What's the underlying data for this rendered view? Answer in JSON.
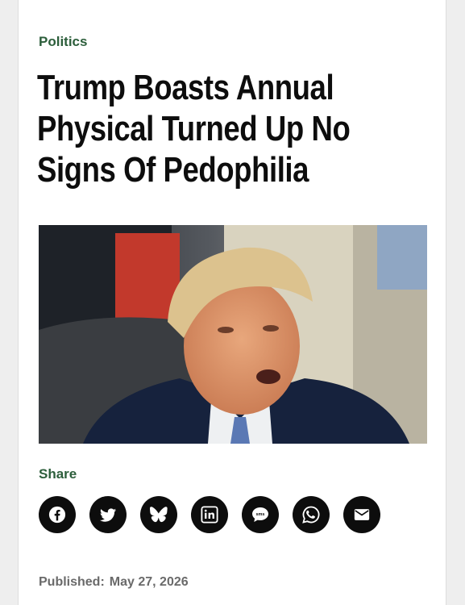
{
  "article": {
    "category": "Politics",
    "headline": "Trump Boasts Annual Physical Turned Up No Signs Of Pedophilia",
    "image": {
      "subject": "photo of Donald Trump speaking"
    },
    "share": {
      "label": "Share",
      "buttons": [
        {
          "name": "facebook",
          "icon": "facebook-icon"
        },
        {
          "name": "twitter",
          "icon": "twitter-icon"
        },
        {
          "name": "bluesky",
          "icon": "bluesky-icon"
        },
        {
          "name": "linkedin",
          "icon": "linkedin-icon",
          "glyph": "in"
        },
        {
          "name": "sms",
          "icon": "sms-icon",
          "glyph": "sms"
        },
        {
          "name": "whatsapp",
          "icon": "whatsapp-icon"
        },
        {
          "name": "email",
          "icon": "email-icon"
        }
      ]
    },
    "published_label": "Published:",
    "published_date": "May 27, 2026"
  },
  "colors": {
    "accent": "#2c5e3b",
    "text": "#0d0d0d",
    "muted": "#6a6a6a"
  }
}
